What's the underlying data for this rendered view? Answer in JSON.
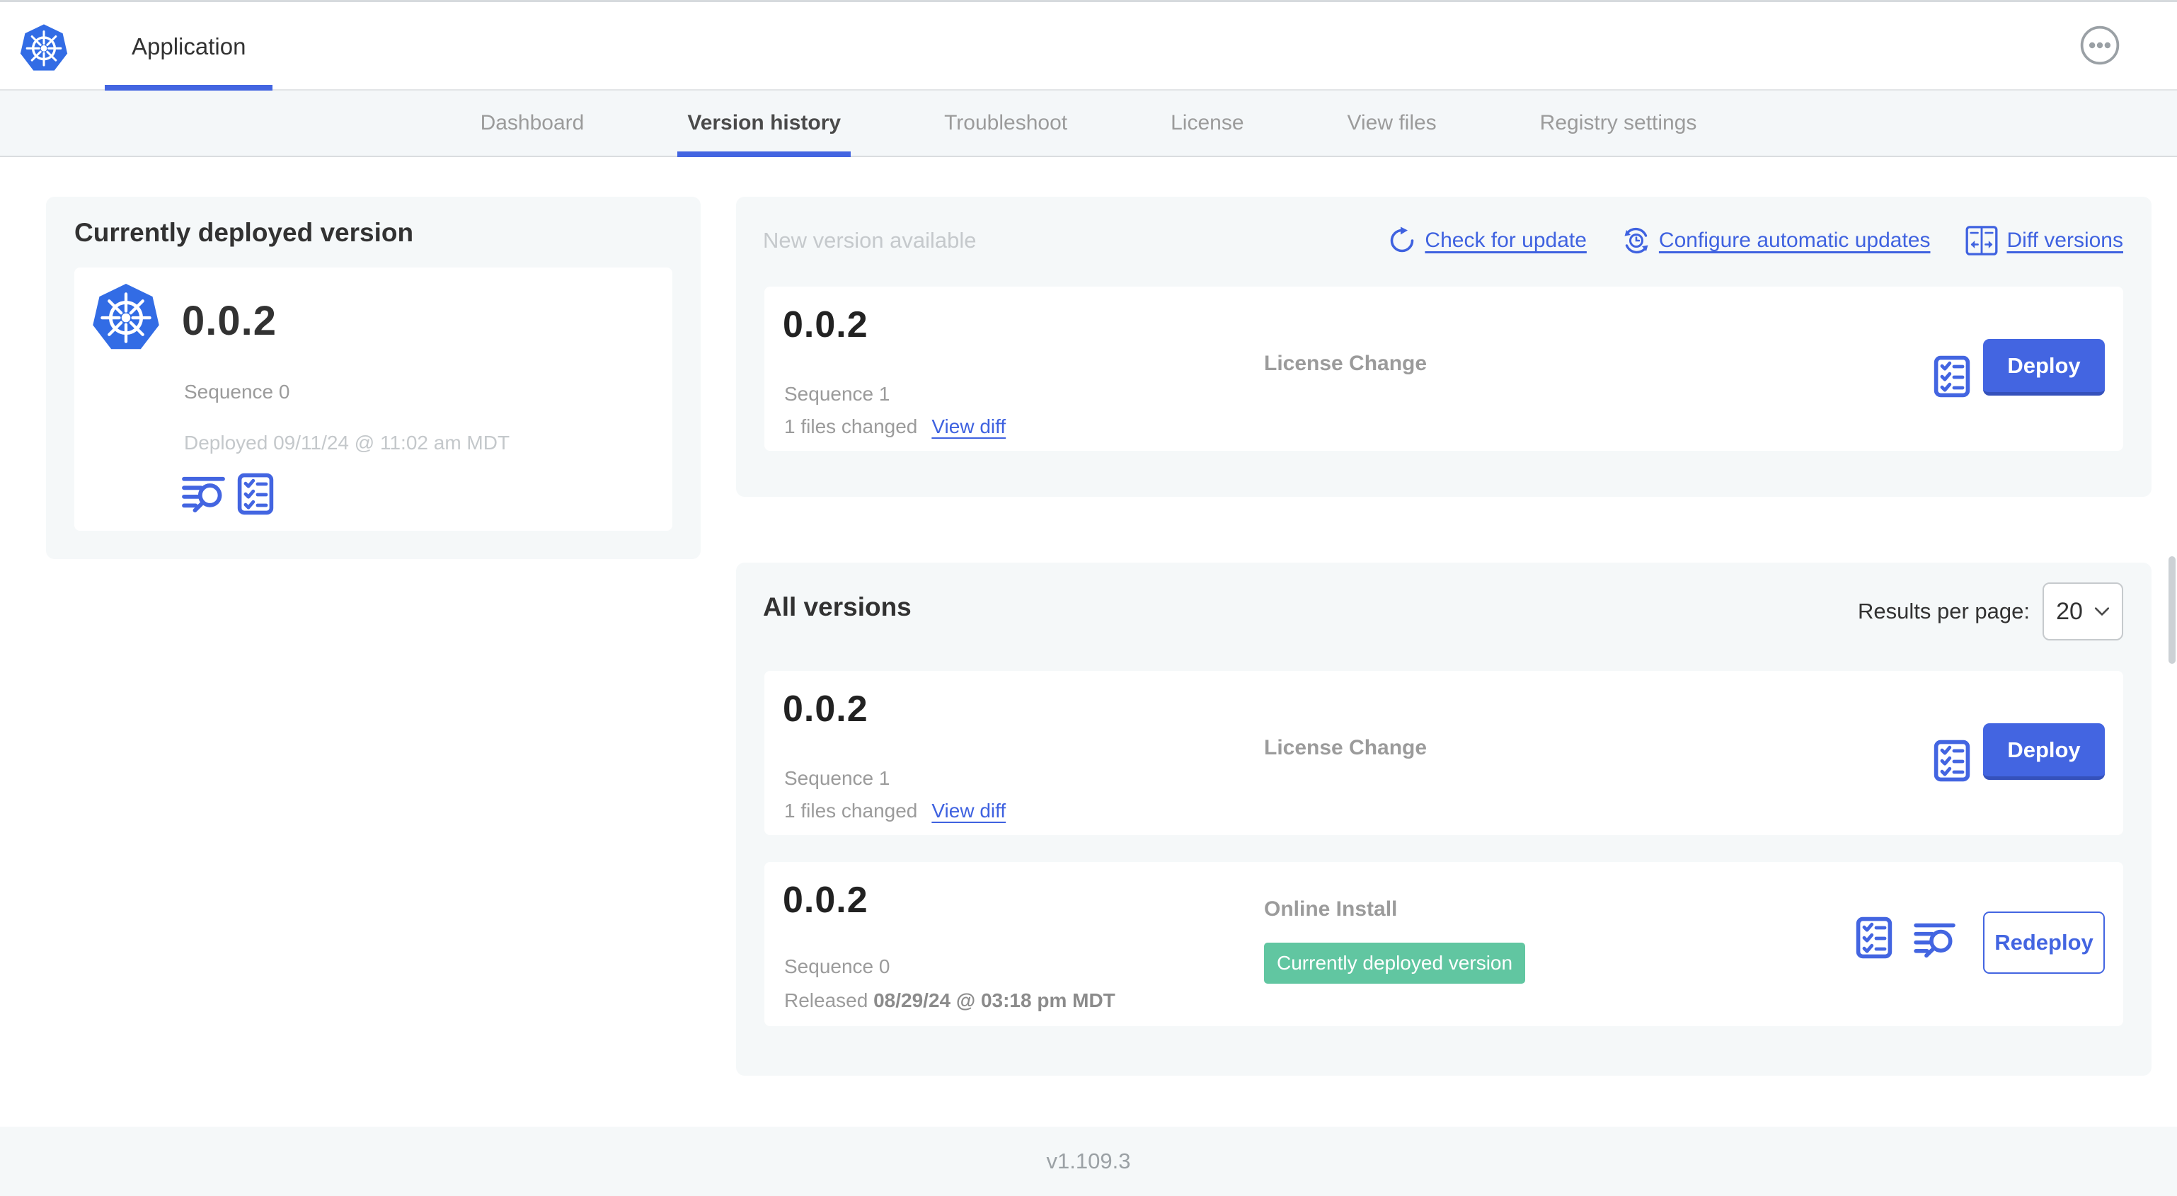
{
  "app": {
    "title": "Application"
  },
  "nav": {
    "tabs": [
      {
        "label": "Dashboard",
        "active": false
      },
      {
        "label": "Version history",
        "active": true
      },
      {
        "label": "Troubleshoot",
        "active": false
      },
      {
        "label": "License",
        "active": false
      },
      {
        "label": "View files",
        "active": false
      },
      {
        "label": "Registry settings",
        "active": false
      }
    ]
  },
  "currently_deployed": {
    "heading": "Currently deployed version",
    "version": "0.0.2",
    "sequence": "Sequence 0",
    "deployed": "Deployed 09/11/24 @ 11:02 am MDT",
    "icons": [
      "logs-icon",
      "preflight-checklist-icon"
    ]
  },
  "new_version": {
    "heading": "New version available",
    "actions": [
      {
        "label": "Check for update",
        "icon": "refresh-icon"
      },
      {
        "label": "Configure automatic updates",
        "icon": "schedule-update-icon"
      },
      {
        "label": "Diff versions",
        "icon": "diff-icon"
      }
    ],
    "row": {
      "version": "0.0.2",
      "sequence": "Sequence 1",
      "files_changed": "1 files changed",
      "view_diff": "View diff",
      "source": "License Change",
      "action": "Deploy"
    }
  },
  "all_versions": {
    "heading": "All versions",
    "results_per_page_label": "Results per page:",
    "results_per_page_value": "20",
    "rows": [
      {
        "version": "0.0.2",
        "sequence": "Sequence 1",
        "files_changed": "1 files changed",
        "view_diff": "View diff",
        "source": "License Change",
        "action": "Deploy"
      },
      {
        "version": "0.0.2",
        "sequence": "Sequence 0",
        "released_prefix": "Released ",
        "released_date": "08/29/24 @ 03:18 pm MDT",
        "source": "Online Install",
        "badge": "Currently deployed version",
        "action": "Redeploy"
      }
    ]
  },
  "footer": {
    "version": "v1.109.3"
  },
  "colors": {
    "accent_blue": "#4365e1",
    "kubernetes_blue": "#326ce5",
    "badge_green": "#61c6a1",
    "card_gray": "#f5f8f9",
    "text_dark": "#323232",
    "text_gray": "#9b9b9b",
    "text_light_gray": "#c5c9cc"
  }
}
